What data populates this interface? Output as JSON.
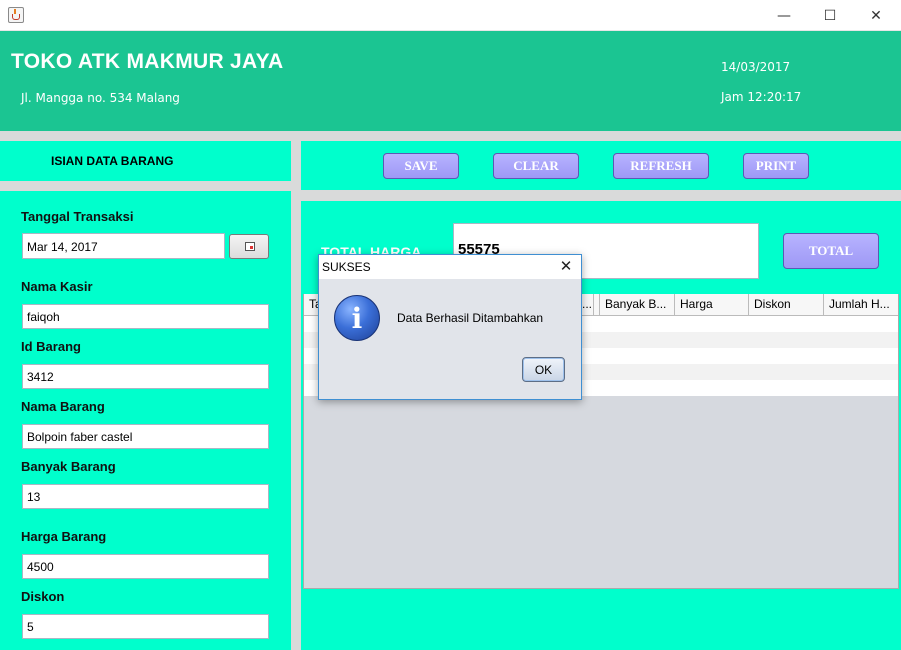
{
  "window": {
    "minimize_glyph": "—",
    "maximize_glyph": "☐",
    "close_glyph": "✕"
  },
  "header": {
    "title": "TOKO ATK MAKMUR JAYA",
    "address": "Jl. Mangga no. 534 Malang",
    "date": "14/03/2017",
    "time": "Jam 12:20:17",
    "bg_color": "#1bc592"
  },
  "form": {
    "section_title": "ISIAN DATA BARANG",
    "fields": [
      {
        "label": "Tanggal Transaksi",
        "value": "Mar 14, 2017"
      },
      {
        "label": "Nama Kasir",
        "value": "faiqoh"
      },
      {
        "label": "Id Barang",
        "value": "3412"
      },
      {
        "label": "Nama Barang",
        "value": "Bolpoin faber castel"
      },
      {
        "label": "Banyak Barang",
        "value": "13"
      },
      {
        "label": "Harga Barang",
        "value": "4500"
      },
      {
        "label": "Diskon",
        "value": "5"
      }
    ],
    "panel_color": "#00ffcc"
  },
  "toolbar": {
    "save_label": "SAVE",
    "clear_label": "CLEAR",
    "refresh_label": "REFRESH",
    "print_label": "PRINT",
    "button_color": "#a8a3ff"
  },
  "total": {
    "label": "TOTAL HARGA",
    "value": "55575",
    "button_label": "TOTAL"
  },
  "table": {
    "columns": [
      "Ta",
      "",
      "Banyak B...",
      "Harga",
      "Diskon",
      "Jumlah H..."
    ],
    "column_ellipsis": "..."
  },
  "dialog": {
    "title": "SUKSES",
    "message": "Data Berhasil Ditambahkan",
    "ok_label": "OK",
    "close_glyph": "✕",
    "icon": "info-icon",
    "icon_glyph": "i"
  }
}
